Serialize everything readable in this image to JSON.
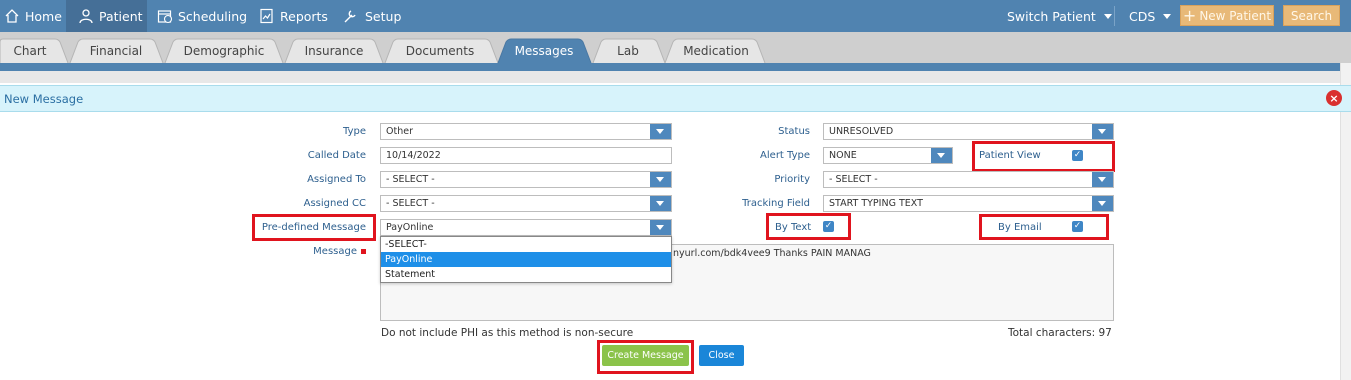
{
  "nav": {
    "home": "Home",
    "patient": "Patient",
    "scheduling": "Scheduling",
    "reports": "Reports",
    "setup": "Setup",
    "switch_patient": "Switch Patient",
    "cds": "CDS",
    "new_patient": "New Patient",
    "search": "Search"
  },
  "tabs": [
    "Chart",
    "Financial",
    "Demographic",
    "Insurance",
    "Documents",
    "Messages",
    "Lab",
    "Medication"
  ],
  "active_tab": "Messages",
  "panel": {
    "title": "New Message"
  },
  "form": {
    "type_label": "Type",
    "type_value": "Other",
    "called_date_label": "Called Date",
    "called_date_value": "10/14/2022",
    "assigned_to_label": "Assigned To",
    "assigned_to_value": "- SELECT -",
    "assigned_cc_label": "Assigned CC",
    "assigned_cc_value": "- SELECT -",
    "predefined_label": "Pre-defined Message",
    "predefined_value": "PayOnline",
    "message_label": "Message",
    "message_text": "nyurl.com/bdk4vee9 Thanks PAIN MANAG",
    "status_label": "Status",
    "status_value": "UNRESOLVED",
    "alert_type_label": "Alert Type",
    "alert_type_value": "NONE",
    "patient_view_label": "Patient View",
    "priority_label": "Priority",
    "priority_value": "- SELECT -",
    "tracking_label": "Tracking Field",
    "tracking_value": "START TYPING TEXT",
    "by_text_label": "By Text",
    "by_email_label": "By Email"
  },
  "dropdown_options": [
    "-SELECT-",
    "PayOnline",
    "Statement"
  ],
  "dropdown_selected": "PayOnline",
  "notes": {
    "phi_warning": "Do not include PHI as this method is non-secure",
    "total_chars": "Total characters: 97"
  },
  "buttons": {
    "create": "Create Message",
    "close": "Close"
  },
  "colors": {
    "nav_bg": "#5083b0",
    "highlight_red": "#e0141e",
    "create_green": "#8bc34a",
    "close_blue": "#1a86d8"
  }
}
